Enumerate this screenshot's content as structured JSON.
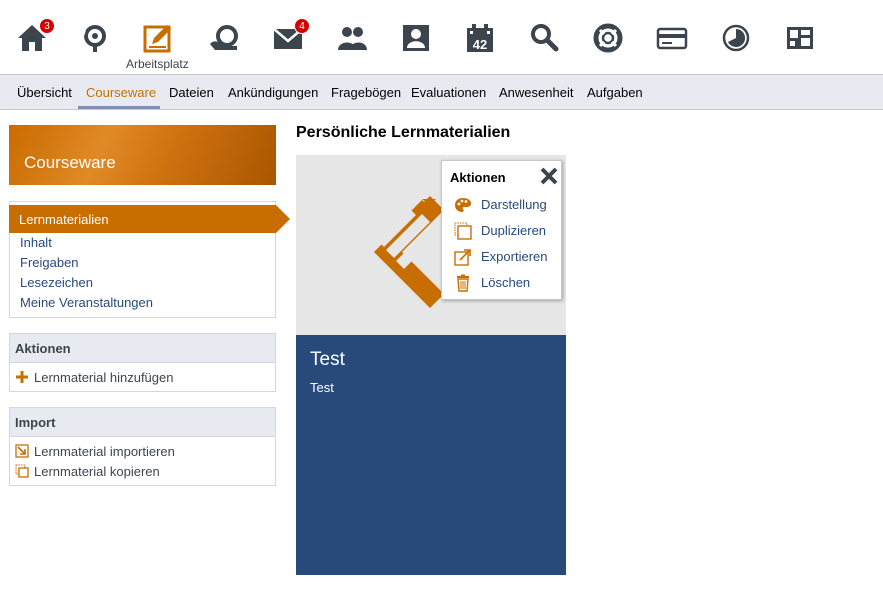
{
  "topbar": {
    "items": [
      {
        "name": "home-icon",
        "badge": "3"
      },
      {
        "name": "activity-icon"
      },
      {
        "name": "arbeitsplatz-icon",
        "label": "Arbeitsplatz"
      },
      {
        "name": "community-icon"
      },
      {
        "name": "mail-icon",
        "badge": "4"
      },
      {
        "name": "contacts-icon"
      },
      {
        "name": "profile-icon"
      },
      {
        "name": "calendar-icon",
        "day": "42"
      },
      {
        "name": "search-icon"
      },
      {
        "name": "help-icon"
      },
      {
        "name": "card-icon"
      },
      {
        "name": "stats-icon"
      },
      {
        "name": "layout-icon"
      }
    ]
  },
  "tabs": [
    "Übersicht",
    "Courseware",
    "Dateien",
    "Ankündigungen",
    "Fragebögen",
    "Evaluationen",
    "Anwesenheit",
    "Aufgaben"
  ],
  "active_tab": "Courseware",
  "sidebar": {
    "title": "Courseware",
    "nav": [
      "Lernmaterialien",
      "Inhalt",
      "Freigaben",
      "Lesezeichen",
      "Meine Veranstaltungen"
    ],
    "actions": {
      "title": "Aktionen",
      "items": [
        "Lernmaterial hinzufügen"
      ]
    },
    "import": {
      "title": "Import",
      "items": [
        "Lernmaterial importieren",
        "Lernmaterial kopieren"
      ]
    }
  },
  "main": {
    "title": "Persönliche Lernmaterialien",
    "card": {
      "title": "Test",
      "subtitle": "Test"
    },
    "menu": {
      "title": "Aktionen",
      "items": [
        "Darstellung",
        "Duplizieren",
        "Exportieren",
        "Löschen"
      ]
    }
  },
  "colors": {
    "accent": "#c86e00",
    "primary": "#284a7b",
    "badge": "#d60000",
    "icon": "#3c454e"
  }
}
